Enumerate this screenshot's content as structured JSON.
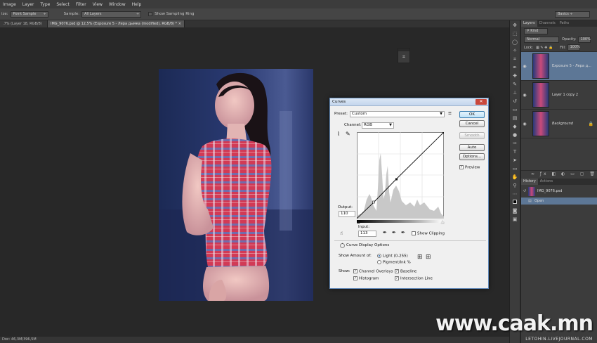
{
  "menu": [
    "Image",
    "Layer",
    "Type",
    "Select",
    "Filter",
    "View",
    "Window",
    "Help"
  ],
  "options_bar": {
    "size_label": "ize:",
    "size_value": "Point Sample",
    "sample_label": "Sample:",
    "sample_value": "All Layers",
    "show_ring": "Show Sampling Ring",
    "workspace": "Basics ÷"
  },
  "tabs": [
    {
      "label": ".7% (Layer 18, RGB/8) * ×"
    },
    {
      "label": "IMG_9076.psd @ 12,5% (Exposure 5 - Лера дымка (modified), RGB/8) * ×"
    }
  ],
  "status": "Doc: 46,3M/396,5M",
  "layers_panel": {
    "tabs": [
      "Layers",
      "Channels",
      "Paths"
    ],
    "filter": "Kind",
    "blend": "Normal",
    "opacity_label": "Opacity:",
    "opacity": "100%",
    "lock_label": "Lock:",
    "fill_label": "Fill:",
    "fill": "100%",
    "layers": [
      {
        "name": "Exposure 5 - Лера д...",
        "selected": true
      },
      {
        "name": "Layer 1 copy 2",
        "selected": false
      },
      {
        "name": "Background",
        "selected": false
      }
    ]
  },
  "history_panel": {
    "tabs": [
      "History",
      "Actions"
    ],
    "items": [
      {
        "name": "IMG_9076.psd"
      },
      {
        "name": "Open"
      }
    ]
  },
  "curves": {
    "title": "Curves",
    "preset_label": "Preset:",
    "preset": "Custom",
    "channel_label": "Channel:",
    "channel": "RGB",
    "output_label": "Output:",
    "output": "110",
    "input_label": "Input:",
    "input": "113",
    "show_clipping": "Show Clipping",
    "buttons": {
      "ok": "OK",
      "cancel": "Cancel",
      "smooth": "Smooth",
      "auto": "Auto",
      "options": "Options..."
    },
    "preview": "Preview",
    "display_options": "Curve Display Options",
    "show_amount_label": "Show Amount of:",
    "light": "Light  (0-255)",
    "pigment": "Pigment/Ink %",
    "show_label": "Show:",
    "channel_overlays": "Channel Overlays",
    "baseline": "Baseline",
    "histogram": "Histogram",
    "intersection": "Intersection Line"
  },
  "watermark": {
    "main": "www.caak.mn",
    "sub": "LETOHIN.LIVEJOURNAL.COM"
  }
}
